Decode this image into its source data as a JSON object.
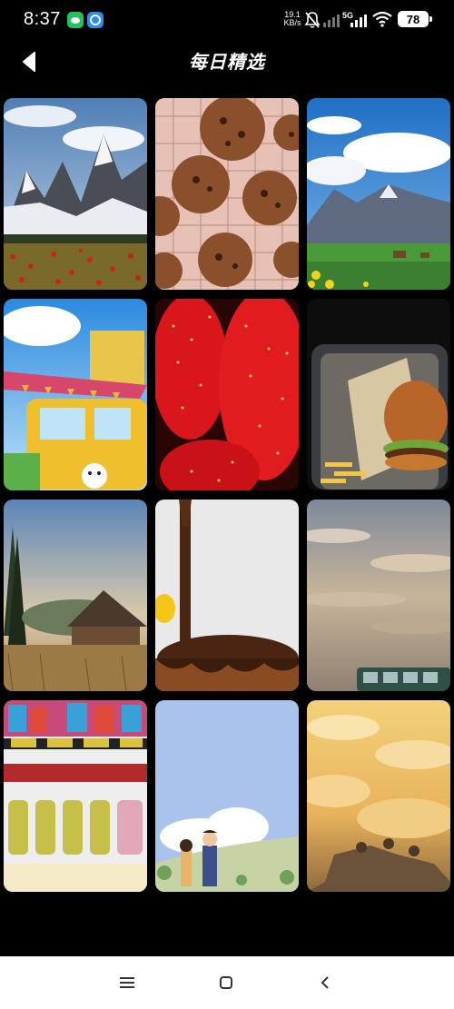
{
  "status_bar": {
    "time": "8:37",
    "net_speed_value": "19.1",
    "net_speed_unit": "KB/s",
    "network_type": "5G",
    "battery_level": "78"
  },
  "header": {
    "title": "每日精选"
  },
  "gallery": {
    "items": [
      {
        "subject": "snowy-mountains-poppy-field"
      },
      {
        "subject": "chocolate-chip-cookies-on-rack"
      },
      {
        "subject": "alpine-valley-blue-sky"
      },
      {
        "subject": "yellow-van-bunting-illustration"
      },
      {
        "subject": "strawberries-closeup"
      },
      {
        "subject": "burger-in-tray"
      },
      {
        "subject": "wooden-cabin-meadow"
      },
      {
        "subject": "chocolate-drizzle-dessert"
      },
      {
        "subject": "cloudy-sky-bus-roof"
      },
      {
        "subject": "vending-machine-drinks"
      },
      {
        "subject": "couple-illustration-sky"
      },
      {
        "subject": "golden-clouds-illustration"
      }
    ]
  },
  "nav": {
    "icons": [
      "menu-icon",
      "home-square-icon",
      "back-chevron-icon"
    ]
  }
}
